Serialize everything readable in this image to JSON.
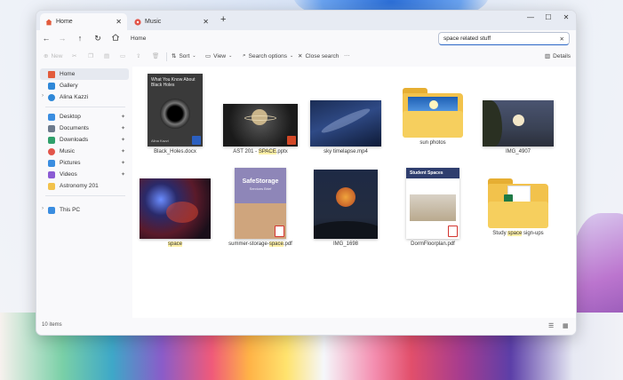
{
  "window": {
    "tabs": [
      {
        "label": "Home",
        "active": true
      },
      {
        "label": "Music",
        "active": false
      }
    ],
    "new_tab": "+",
    "controls": {
      "minimize": "—",
      "maximize": "☐",
      "close": "✕"
    }
  },
  "address_bar": {
    "back": "←",
    "forward": "→",
    "up": "↑",
    "refresh": "↻",
    "path": "Home",
    "search_query": "space related stuff",
    "search_clear": "✕"
  },
  "toolbar": {
    "new": "New",
    "sort": "Sort",
    "view": "View",
    "search_options": "Search options",
    "close_search": "Close search",
    "more": "···",
    "details": "Details"
  },
  "sidebar": {
    "items": [
      {
        "label": "Home",
        "icon": "home-icon",
        "color": "#e25b3c"
      },
      {
        "label": "Gallery",
        "icon": "gallery-icon",
        "color": "#2f88d8"
      },
      {
        "label": "Alina Kazzi",
        "icon": "cloud-icon",
        "color": "#2f88d8"
      },
      {
        "label": "Desktop",
        "icon": "desktop-icon",
        "color": "#3a8de0"
      },
      {
        "label": "Documents",
        "icon": "documents-icon",
        "color": "#6c7a8c"
      },
      {
        "label": "Downloads",
        "icon": "downloads-icon",
        "color": "#2fa06b"
      },
      {
        "label": "Music",
        "icon": "music-icon",
        "color": "#e2554a"
      },
      {
        "label": "Pictures",
        "icon": "pictures-icon",
        "color": "#3a8de0"
      },
      {
        "label": "Videos",
        "icon": "videos-icon",
        "color": "#8b5bd4"
      },
      {
        "label": "Astronomy 201",
        "icon": "folder-icon",
        "color": "#f2c24c"
      },
      {
        "label": "This PC",
        "icon": "pc-icon",
        "color": "#3a8de0"
      }
    ],
    "pin_glyph": "✦"
  },
  "files": [
    {
      "name": "Black_Holes.docx",
      "thumb_title": "What You Know About Black Holes",
      "thumb_author": "Alina Kazzi"
    },
    {
      "name_parts": [
        "AST 201 - ",
        "SPACE",
        ".pptx"
      ]
    },
    {
      "name": "sky timelapse.mp4"
    },
    {
      "name": "sun photos"
    },
    {
      "name": "IMG_4907"
    },
    {
      "name_parts": [
        "",
        "space",
        ""
      ]
    },
    {
      "name_parts": [
        "summer-storage-",
        "space",
        ".pdf"
      ],
      "thumb_title": "SafeStorage",
      "thumb_sub": "Services Brief"
    },
    {
      "name": "IMG_1698"
    },
    {
      "name": "DormFloorplan.pdf",
      "thumb_title": "Student Spaces"
    },
    {
      "name_parts": [
        "Study ",
        "space",
        " sign-ups"
      ]
    }
  ],
  "status": {
    "count": "10 items"
  },
  "colors": {
    "accent": "#2a66c6",
    "highlight": "#fff1a8",
    "folder": "#f2c24c"
  }
}
